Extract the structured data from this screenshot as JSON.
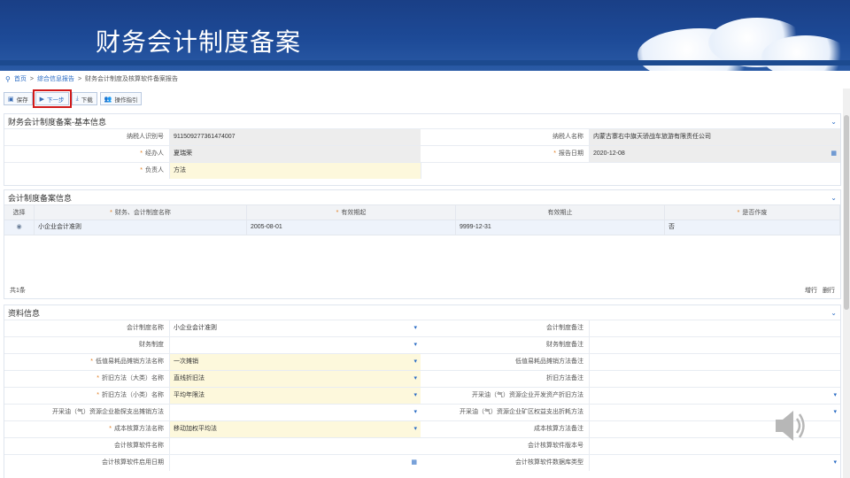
{
  "slide": {
    "title": "财务会计制度备案"
  },
  "breadcrumb": {
    "home": "首页",
    "section": "综合信息报告",
    "current": "财务会计制度及核算软件备案报告",
    "sep": ">"
  },
  "toolbar": {
    "save": "保存",
    "next": "下一步",
    "download": "下载",
    "guide": "操作指引"
  },
  "basic": {
    "title": "财务会计制度备案-基本信息",
    "taxpayer_id_label": "纳税人识别号",
    "taxpayer_id": "911509277361474007",
    "taxpayer_name_label": "纳税人名称",
    "taxpayer_name": "内蒙古寨右中旗天骄战车旅游有限责任公司",
    "handler_label": "经办人",
    "handler": "夏瑞荣",
    "report_date_label": "报告日期",
    "report_date": "2020-12-08",
    "principal_label": "负责人",
    "principal": "方法"
  },
  "filing": {
    "title": "会计制度备案信息",
    "columns": [
      "选择",
      "财务、会计制度名称",
      "有效期起",
      "有效期止",
      "是否作废"
    ],
    "rows": [
      {
        "name": "小企业会计准则",
        "start": "2005-08-01",
        "end": "9999-12-31",
        "void": "否"
      }
    ],
    "total": "共1条",
    "add_row": "增行",
    "del_row": "删行"
  },
  "materials": {
    "title": "资料信息",
    "rows": [
      {
        "l1": "会计制度名称",
        "v1": "小企业会计准则",
        "req1": false,
        "c1": "white",
        "dd1": true,
        "l2": "会计制度备注",
        "v2": ""
      },
      {
        "l1": "财务制度",
        "v1": "",
        "req1": false,
        "c1": "white",
        "dd1": true,
        "l2": "财务制度备注",
        "v2": ""
      },
      {
        "l1": "低值易耗品摊销方法名称",
        "v1": "一次摊销",
        "req1": true,
        "c1": "yellow",
        "dd1": true,
        "l2": "低值易耗品摊销方法备注",
        "v2": ""
      },
      {
        "l1": "折旧方法（大类）名称",
        "v1": "直线折旧法",
        "req1": true,
        "c1": "yellow",
        "dd1": true,
        "l2": "折旧方法备注",
        "v2": ""
      },
      {
        "l1": "折旧方法（小类）名称",
        "v1": "平均年限法",
        "req1": true,
        "c1": "yellow",
        "dd1": true,
        "l2": "开采油（气）资源企业开发资产折旧方法",
        "v2": "",
        "dd2": true
      },
      {
        "l1": "开采油（气）资源企业勘探支出摊销方法",
        "v1": "",
        "req1": false,
        "c1": "white",
        "dd1": true,
        "l2": "开采油（气）资源企业矿区权益支出折耗方法",
        "v2": "",
        "dd2": true
      },
      {
        "l1": "成本核算方法名称",
        "v1": "移动加权平均法",
        "req1": true,
        "c1": "yellow",
        "dd1": true,
        "l2": "成本核算方法备注",
        "v2": ""
      },
      {
        "l1": "会计核算软件名称",
        "v1": "",
        "req1": false,
        "c1": "white",
        "dd1": false,
        "l2": "会计核算软件版本号",
        "v2": ""
      },
      {
        "l1": "会计核算软件启用日期",
        "v1": "",
        "req1": false,
        "c1": "white",
        "cal1": true,
        "l2": "会计核算软件数据库类型",
        "v2": "",
        "dd2": true
      }
    ]
  },
  "colors": {
    "banner": "#1d4a97",
    "accent": "#2b6cc4",
    "required": "#e07b1c",
    "highlight": "#d11a1a",
    "field_yellow": "#fdf8dc",
    "field_gray": "#ededed"
  },
  "icons": {
    "save": "save-icon",
    "next": "play-icon",
    "download": "download-icon",
    "guide": "users-icon",
    "date": "calendar-icon",
    "dropdown": "caret-down-icon",
    "speaker": "speaker-icon"
  }
}
